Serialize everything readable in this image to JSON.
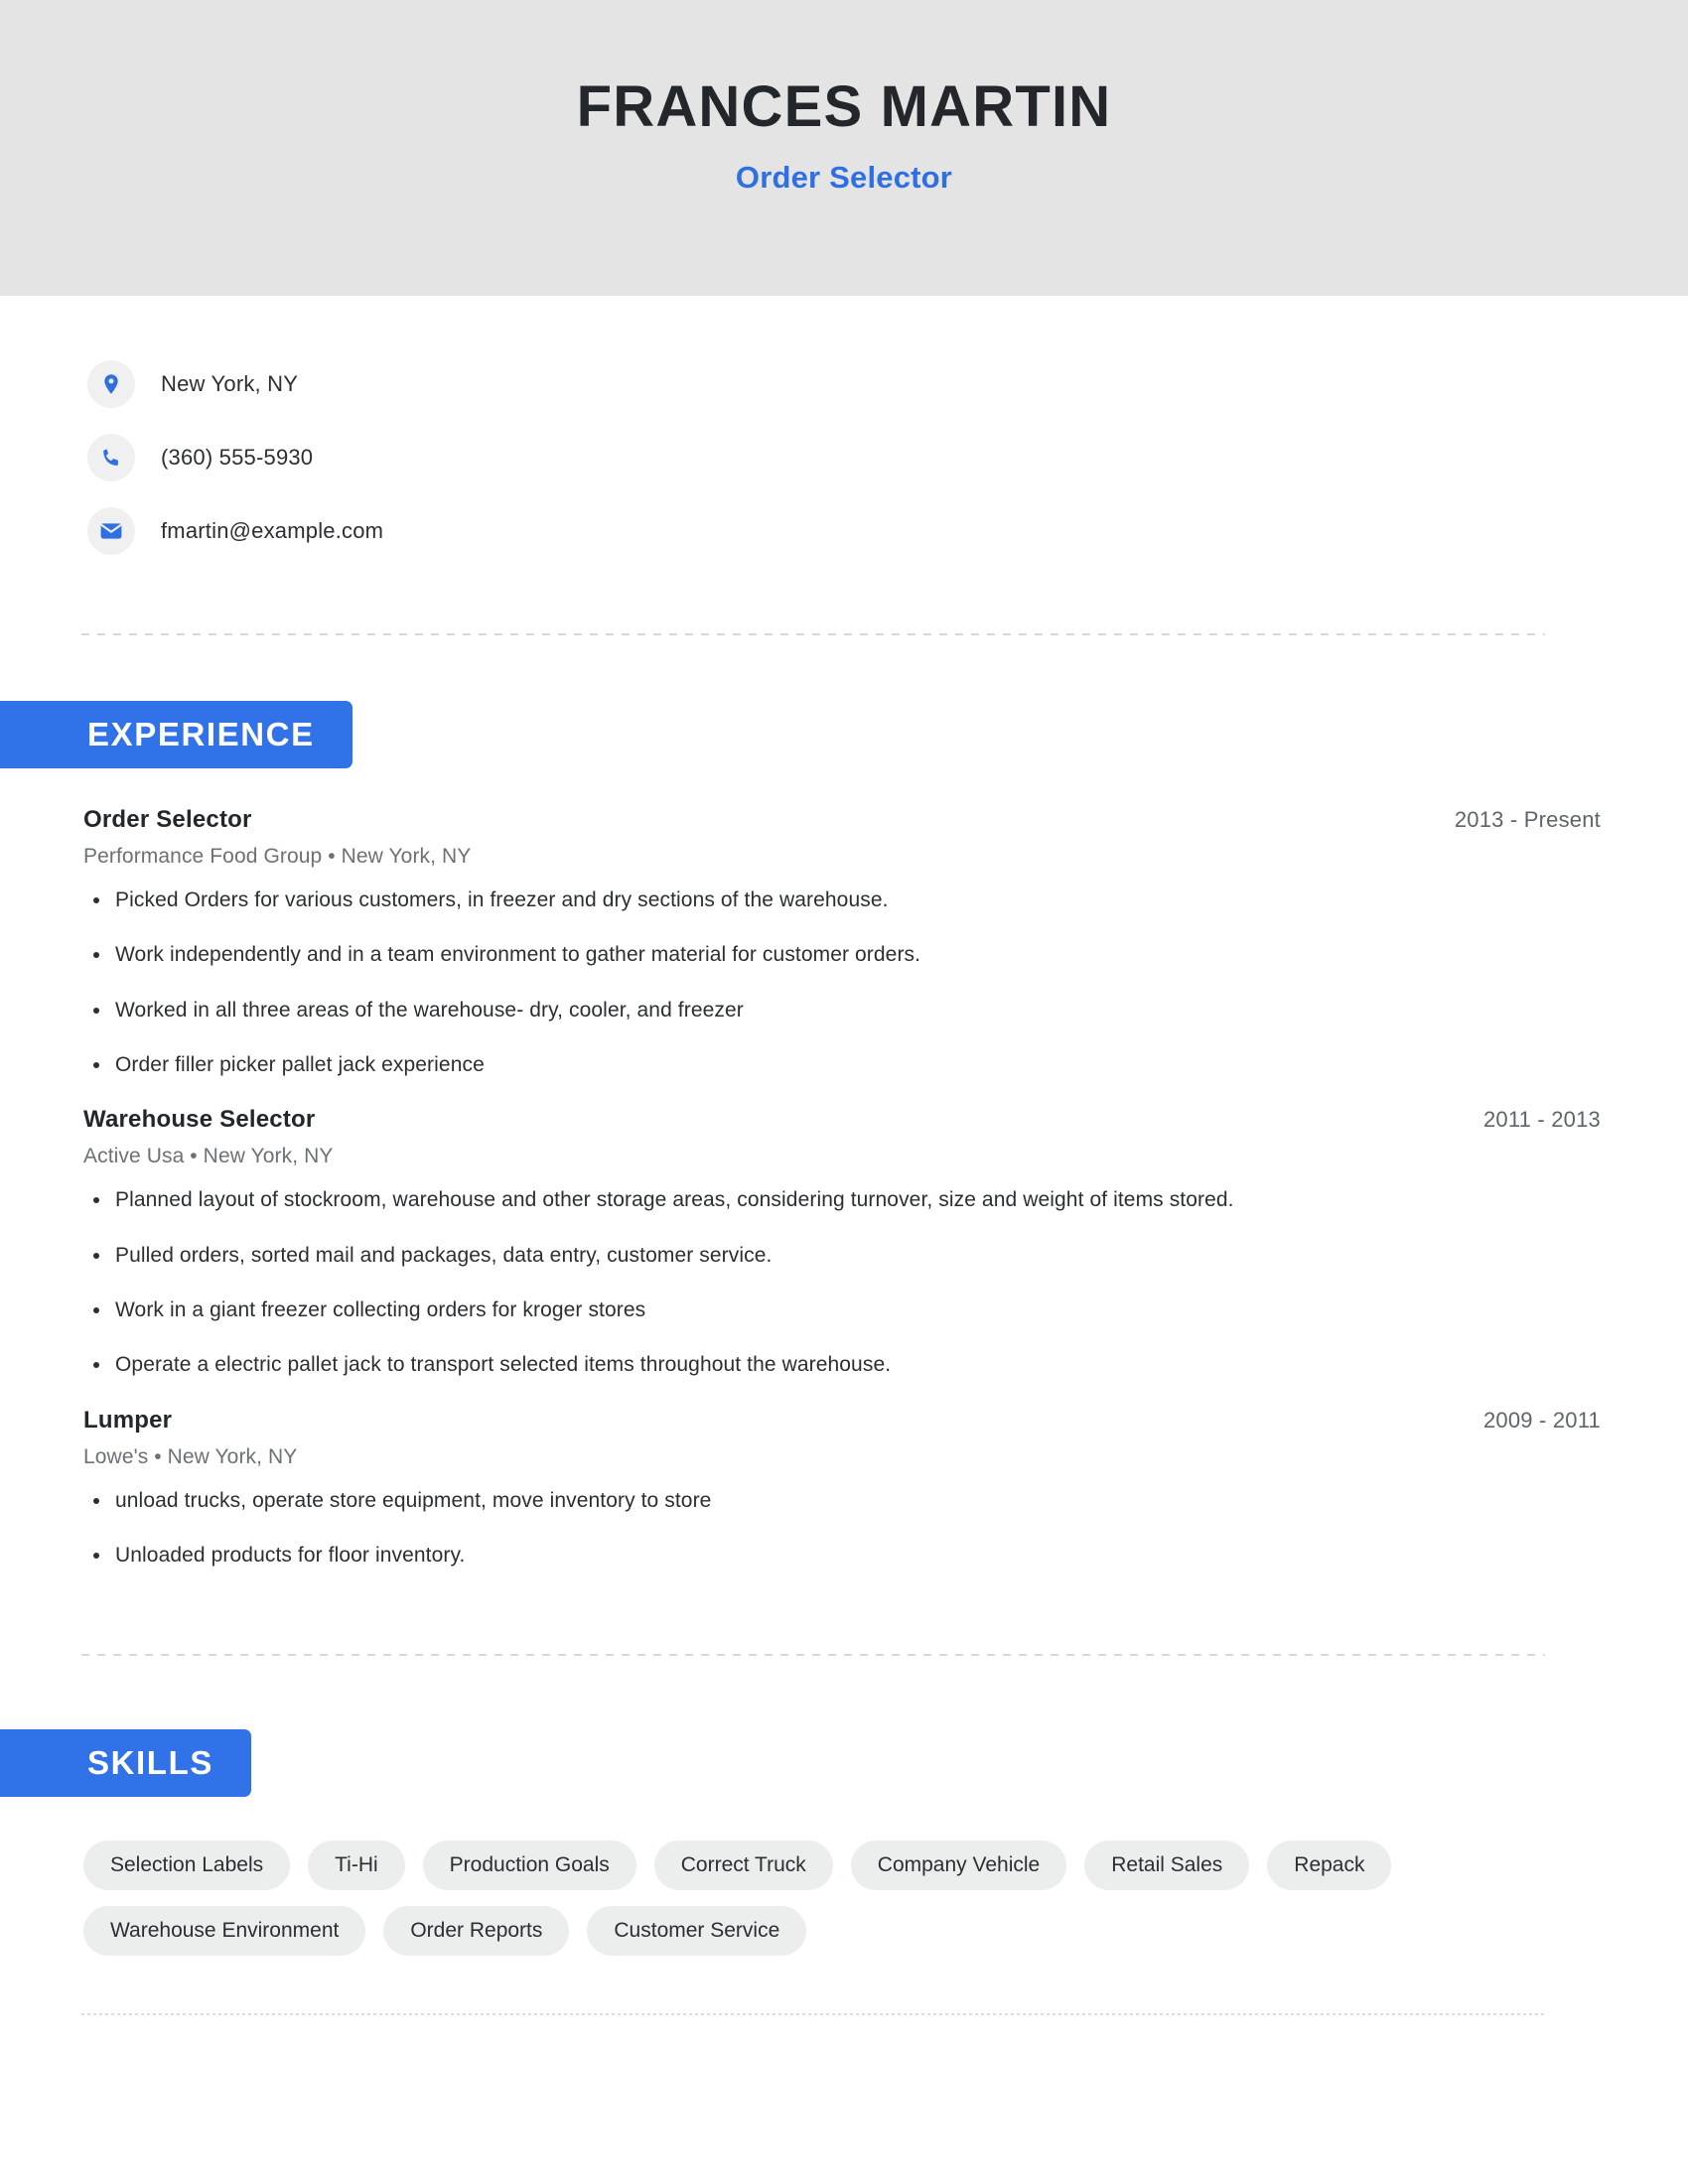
{
  "header": {
    "name": "FRANCES MARTIN",
    "title": "Order Selector",
    "background_color": "#e4e4e4",
    "accent_color": "#3272e8"
  },
  "contact": {
    "location": "New York, NY",
    "phone": "(360) 555-5930",
    "email": "fmartin@example.com",
    "icons": [
      "location-pin-icon",
      "phone-icon",
      "envelope-icon"
    ]
  },
  "sections": {
    "experience_label": "EXPERIENCE",
    "skills_label": "SKILLS"
  },
  "experience": [
    {
      "role": "Order Selector",
      "dates": "2013 - Present",
      "meta": "Performance Food Group • New York, NY",
      "bullets": [
        "Picked Orders for various customers, in freezer and dry sections of the warehouse.",
        "Work independently and in a team environment to gather material for customer orders.",
        "Worked in all three areas of the warehouse- dry, cooler, and freezer",
        "Order filler picker pallet jack experience"
      ]
    },
    {
      "role": "Warehouse Selector",
      "dates": "2011 - 2013",
      "meta": "Active Usa  • New York, NY",
      "bullets": [
        "Planned layout of stockroom, warehouse and other storage areas, considering turnover, size and weight of items stored.",
        "Pulled orders, sorted mail and packages, data entry, customer service.",
        "Work in a giant freezer collecting orders for kroger stores",
        "Operate a electric pallet jack to transport selected items throughout the warehouse."
      ]
    },
    {
      "role": "Lumper",
      "dates": "2009 - 2011",
      "meta": "Lowe's • New York, NY",
      "bullets": [
        "unload trucks, operate store equipment, move inventory to store",
        "Unloaded products for floor inventory."
      ]
    }
  ],
  "skills": [
    "Selection Labels",
    "Ti-Hi",
    "Production Goals",
    "Correct Truck",
    "Company Vehicle",
    "Retail Sales",
    "Repack",
    "Warehouse Environment",
    "Order Reports",
    "Customer Service"
  ]
}
